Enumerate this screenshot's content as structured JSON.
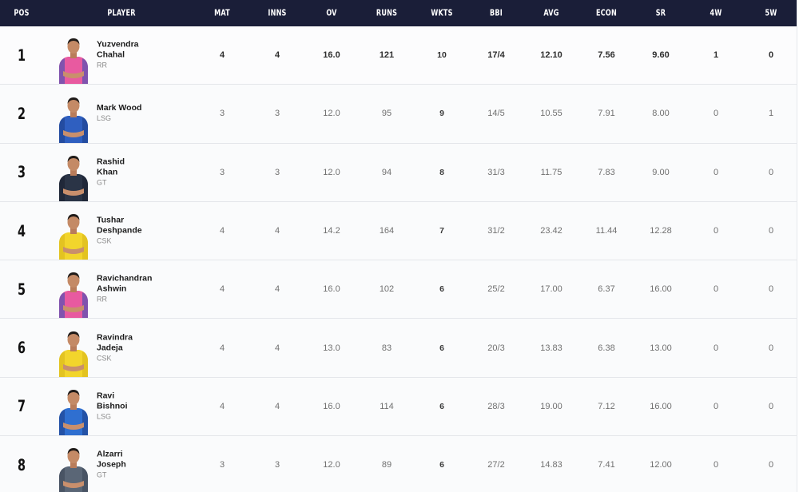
{
  "columns": [
    "POS",
    "PLAYER",
    "MAT",
    "INNS",
    "OV",
    "RUNS",
    "WKTS",
    "BBI",
    "AVG",
    "ECON",
    "SR",
    "4W",
    "5W"
  ],
  "highlight_column": "WKTS",
  "colors": {
    "header_bg": "#1a1e38",
    "highlight_col_bg": "#eef0f2",
    "row_bg": "#fafbfc"
  },
  "rows": [
    {
      "pos": "1",
      "name_line1": "Yuzvendra",
      "name_line2": "Chahal",
      "team": "RR",
      "jersey": "#e85aa0",
      "jersey2": "#3b4fb8",
      "mat": "4",
      "inns": "4",
      "ov": "16.0",
      "runs": "121",
      "wkts": "10",
      "bbi": "17/4",
      "avg": "12.10",
      "econ": "7.56",
      "sr": "9.60",
      "w4": "1",
      "w5": "0"
    },
    {
      "pos": "2",
      "name_line1": "Mark Wood",
      "name_line2": "",
      "team": "LSG",
      "jersey": "#2f5fc0",
      "jersey2": "#1e3f8a",
      "mat": "3",
      "inns": "3",
      "ov": "12.0",
      "runs": "95",
      "wkts": "9",
      "bbi": "14/5",
      "avg": "10.55",
      "econ": "7.91",
      "sr": "8.00",
      "w4": "0",
      "w5": "1"
    },
    {
      "pos": "3",
      "name_line1": "Rashid",
      "name_line2": "Khan",
      "team": "GT",
      "jersey": "#2a3446",
      "jersey2": "#1b2230",
      "mat": "3",
      "inns": "3",
      "ov": "12.0",
      "runs": "94",
      "wkts": "8",
      "bbi": "31/3",
      "avg": "11.75",
      "econ": "7.83",
      "sr": "9.00",
      "w4": "0",
      "w5": "0"
    },
    {
      "pos": "4",
      "name_line1": "Tushar",
      "name_line2": "Deshpande",
      "team": "CSK",
      "jersey": "#f2d52c",
      "jersey2": "#d9b81a",
      "mat": "4",
      "inns": "4",
      "ov": "14.2",
      "runs": "164",
      "wkts": "7",
      "bbi": "31/2",
      "avg": "23.42",
      "econ": "11.44",
      "sr": "12.28",
      "w4": "0",
      "w5": "0"
    },
    {
      "pos": "5",
      "name_line1": "Ravichandran",
      "name_line2": "Ashwin",
      "team": "RR",
      "jersey": "#e85aa0",
      "jersey2": "#3b4fb8",
      "mat": "4",
      "inns": "4",
      "ov": "16.0",
      "runs": "102",
      "wkts": "6",
      "bbi": "25/2",
      "avg": "17.00",
      "econ": "6.37",
      "sr": "16.00",
      "w4": "0",
      "w5": "0"
    },
    {
      "pos": "6",
      "name_line1": "Ravindra",
      "name_line2": "Jadeja",
      "team": "CSK",
      "jersey": "#f2d52c",
      "jersey2": "#d9b81a",
      "mat": "4",
      "inns": "4",
      "ov": "13.0",
      "runs": "83",
      "wkts": "6",
      "bbi": "20/3",
      "avg": "13.83",
      "econ": "6.38",
      "sr": "13.00",
      "w4": "0",
      "w5": "0"
    },
    {
      "pos": "7",
      "name_line1": "Ravi",
      "name_line2": "Bishnoi",
      "team": "LSG",
      "jersey": "#2f6fd0",
      "jersey2": "#1e3f8a",
      "mat": "4",
      "inns": "4",
      "ov": "16.0",
      "runs": "114",
      "wkts": "6",
      "bbi": "28/3",
      "avg": "19.00",
      "econ": "7.12",
      "sr": "16.00",
      "w4": "0",
      "w5": "0"
    },
    {
      "pos": "8",
      "name_line1": "Alzarri",
      "name_line2": "Joseph",
      "team": "GT",
      "jersey": "#5a6676",
      "jersey2": "#3e4858",
      "mat": "3",
      "inns": "3",
      "ov": "12.0",
      "runs": "89",
      "wkts": "6",
      "bbi": "27/2",
      "avg": "14.83",
      "econ": "7.41",
      "sr": "12.00",
      "w4": "0",
      "w5": "0"
    }
  ]
}
